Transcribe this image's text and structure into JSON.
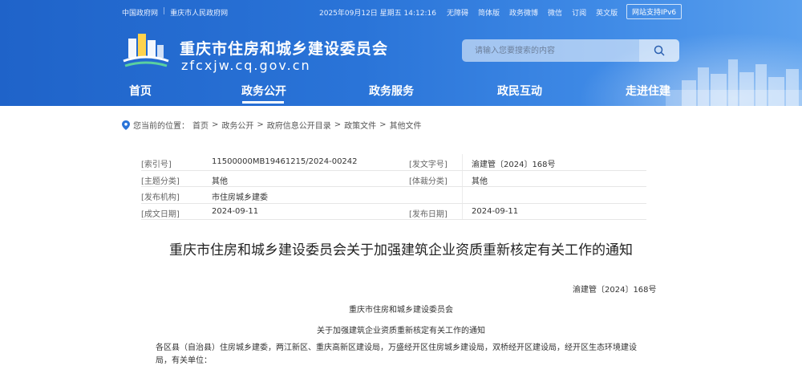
{
  "topbar": {
    "left_links": [
      "中国政府网",
      "重庆市人民政府网"
    ],
    "date": "2025年09月12日 星期五 14:12:16",
    "right_links": [
      "无障碍",
      "简体版",
      "政务微博",
      "微信",
      "订阅",
      "英文版"
    ],
    "ipv6": "网站支持IPv6"
  },
  "site": {
    "name": "重庆市住房和城乡建设委员会",
    "domain": "zfcxjw.cq.gov.cn"
  },
  "search": {
    "placeholder": "请输入您要搜索的内容"
  },
  "nav": [
    "首页",
    "政务公开",
    "政务服务",
    "政民互动",
    "走进住建"
  ],
  "breadcrumb": {
    "prefix": "您当前的位置：",
    "items": [
      "首页",
      "政务公开",
      "政府信息公开目录",
      "政策文件",
      "其他文件"
    ],
    "separator": ">"
  },
  "info": {
    "index_label": "[索引号]",
    "index_value": "11500000MB19461215/2024-00242",
    "doc_label": "[发文字号]",
    "doc_value": "渝建管〔2024〕168号",
    "topic_label": "[主题分类]",
    "topic_value": "其他",
    "genre_label": "[体裁分类]",
    "genre_value": "其他",
    "issuer_label": "[发布机构]",
    "issuer_value": "市住房城乡建委",
    "written_label": "[成文日期]",
    "written_value": "2024-09-11",
    "publish_label": "[发布日期]",
    "publish_value": "2024-09-11"
  },
  "article": {
    "title": "重庆市住房和城乡建设委员会关于加强建筑企业资质重新核定有关工作的通知",
    "doc_number": "渝建管〔2024〕168号",
    "org": "重庆市住房和城乡建设委员会",
    "subtitle": "关于加强建筑企业资质重新核定有关工作的通知",
    "salutation": "各区县（自治县）住房城乡建委，两江新区、重庆高新区建设局，万盛经开区住房城乡建设局，双桥经开区建设局，经开区生态环境建设局，有关单位："
  },
  "colors": {
    "header_blue": "#2a74d8",
    "header_light": "#5aa0ee",
    "text_dark": "#222222"
  }
}
